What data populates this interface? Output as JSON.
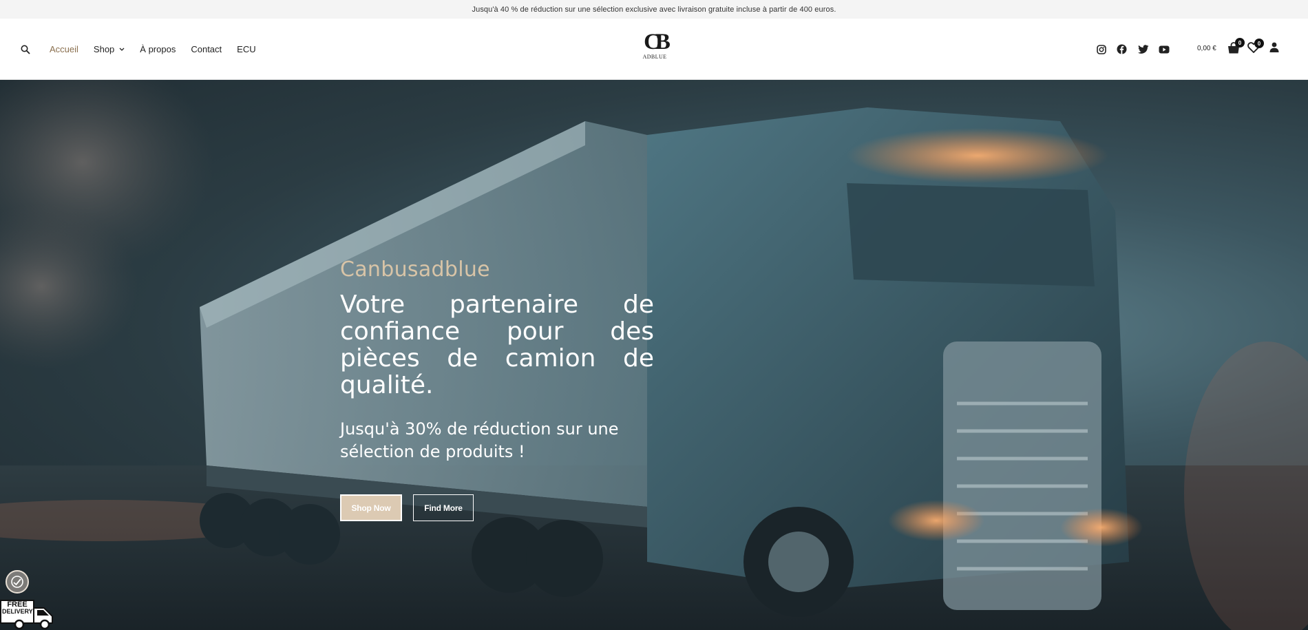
{
  "announcement": "Jusqu'à 40 % de réduction sur une sélection exclusive avec livraison gratuite incluse à partir de 400 euros.",
  "nav": {
    "items": [
      {
        "label": "Accueil",
        "active": true
      },
      {
        "label": "Shop",
        "dropdown": true
      },
      {
        "label": "À propos"
      },
      {
        "label": "Contact"
      },
      {
        "label": "ECU"
      }
    ]
  },
  "logo": {
    "mark": "CB",
    "text": "ADBLUE"
  },
  "social": [
    "instagram-icon",
    "facebook-icon",
    "twitter-icon",
    "youtube-icon"
  ],
  "cart": {
    "total": "0,00 €",
    "count": "0"
  },
  "wishlist": {
    "count": "0"
  },
  "hero": {
    "eyebrow": "Canbusadblue",
    "title": "Votre partenaire de confiance pour des pièces de camion de qualité.",
    "subtitle": "Jusqu'à 30% de réduction sur une sélection de produits !",
    "buttons": {
      "primary": "Shop Now",
      "secondary": "Find More"
    }
  },
  "widgets": {
    "free_delivery": {
      "line1": "FREE",
      "line2": "DELIVERY"
    }
  },
  "colors": {
    "accent": "#8a6f4e",
    "gold": "#d8c4a7",
    "button": "#dccab3"
  }
}
